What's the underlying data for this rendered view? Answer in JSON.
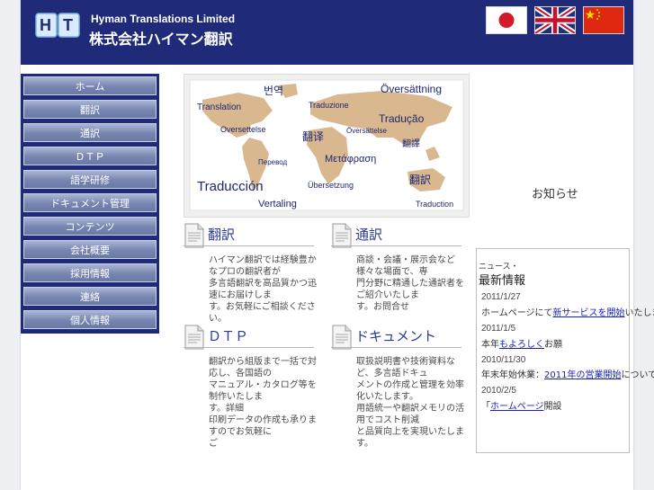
{
  "header": {
    "logo_letters": "HT",
    "company_en": "Hyman Translations Limited",
    "company_jp": "株式会社ハイマン翻訳",
    "flags": [
      "japan-flag",
      "uk-flag",
      "china-flag"
    ]
  },
  "nav": {
    "items": [
      "ホーム",
      "翻訳",
      "通訳",
      "ＤＴＰ",
      "語学研修",
      "ドキュメント管理",
      "コンテンツ",
      "会社概要",
      "採用情報",
      "連絡",
      "個人情報"
    ]
  },
  "map_words": {
    "w1": "번역",
    "w2": "Översättning",
    "w3": "Translation",
    "w4": "Traduzione",
    "w5": "Tradução",
    "w6": "Oversettelse",
    "w7": "翻译",
    "w8": "Översättelse",
    "w9": "翻譯",
    "w10": "Перевод",
    "w11": "Μετάφραση",
    "w12": "翻訳",
    "w13": "Traducción",
    "w14": "Übersetzung",
    "w15": "Vertaling",
    "w16": "Traduction"
  },
  "sections": {
    "s1": {
      "title": "翻訳",
      "body": "ハイマン翻訳では経験豊かなプロの翻訳者が\n多言語翻訳を高品質かつ迅速にお届けしま\nす。お気軽にご相談ください。"
    },
    "s2": {
      "title": "通訳",
      "body": "商談・会議・展示会など様々な場面で、専\n門分野に精通した通訳者をご紹介いたしま\nす。お問合せ"
    },
    "s3": {
      "title": "ＤＴＰ",
      "body": "翻訳から組版まで一括で対応し、各国語の\nマニュアル・カタログ等を制作いたしま\nす。詳細\n印刷データの作成も承りますのでお気軽に\nご"
    },
    "s4": {
      "title": "ドキュメント",
      "body": "取扱説明書や技術資料など、多言語ドキュ\nメントの作成と管理を効率化いたします。\n用語統一や翻訳メモリの活用でコスト削減\nと品質向上を実現いたします。"
    }
  },
  "aside": {
    "title": "お知らせ"
  },
  "news": {
    "kicker": "ニュース・",
    "heading": "最新情報",
    "items": [
      {
        "date": "2011/1/27",
        "pre": "ホームページにて",
        "link": "新サービスを開始",
        "post": "いたしました"
      },
      {
        "date": "2011/1/5",
        "pre": "本年",
        "link": "もよろしく",
        "post": "お願"
      },
      {
        "date": "2010/11/30",
        "pre": "年末年始休業：",
        "link": "2011年の営業開始",
        "post": "について"
      },
      {
        "date": "2010/2/5",
        "pre": "「",
        "link": "ホームページ",
        "post": "開設"
      }
    ]
  },
  "colors": {
    "header_bg": "#1f2a78",
    "nav_item_top": "#a9b6d3",
    "nav_item_bottom": "#6a79a6",
    "title_blue": "#2a3a90",
    "link_blue": "#1a22b8",
    "continent": "#d9b890"
  }
}
